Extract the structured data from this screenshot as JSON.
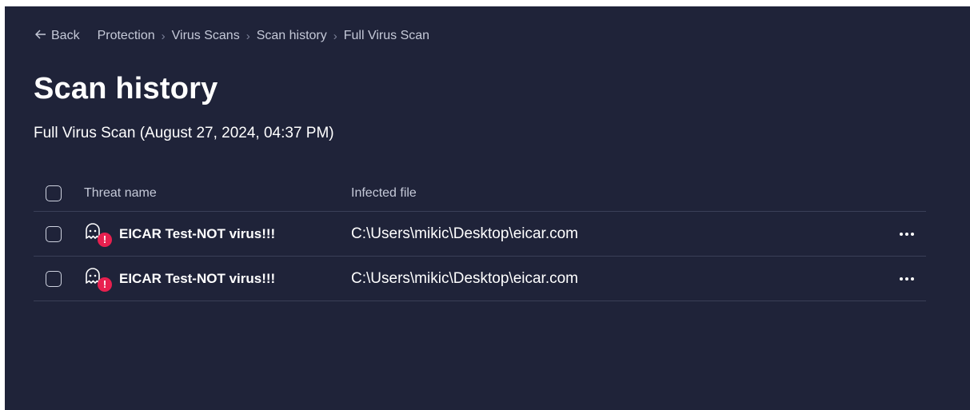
{
  "breadcrumb": {
    "back_label": "Back",
    "items": [
      "Protection",
      "Virus Scans",
      "Scan history",
      "Full Virus Scan"
    ]
  },
  "page": {
    "title": "Scan history",
    "subtitle": "Full Virus Scan (August 27, 2024, 04:37 PM)"
  },
  "table": {
    "columns": {
      "threat": "Threat name",
      "file": "Infected file"
    },
    "rows": [
      {
        "threat": "EICAR Test-NOT virus!!!",
        "file": "C:\\Users\\mikic\\Desktop\\eicar.com"
      },
      {
        "threat": "EICAR Test-NOT virus!!!",
        "file": "C:\\Users\\mikic\\Desktop\\eicar.com"
      }
    ],
    "alert_glyph": "!"
  },
  "icons": {
    "back": "arrow-left-icon",
    "separator": "chevron-right-icon",
    "threat": "ghost-icon",
    "alert": "alert-badge-icon",
    "more": "more-horizontal-icon"
  },
  "colors": {
    "background": "#1f2339",
    "alert": "#e8204f",
    "divider": "#3a3f57",
    "muted_text": "#c5c9d8"
  }
}
